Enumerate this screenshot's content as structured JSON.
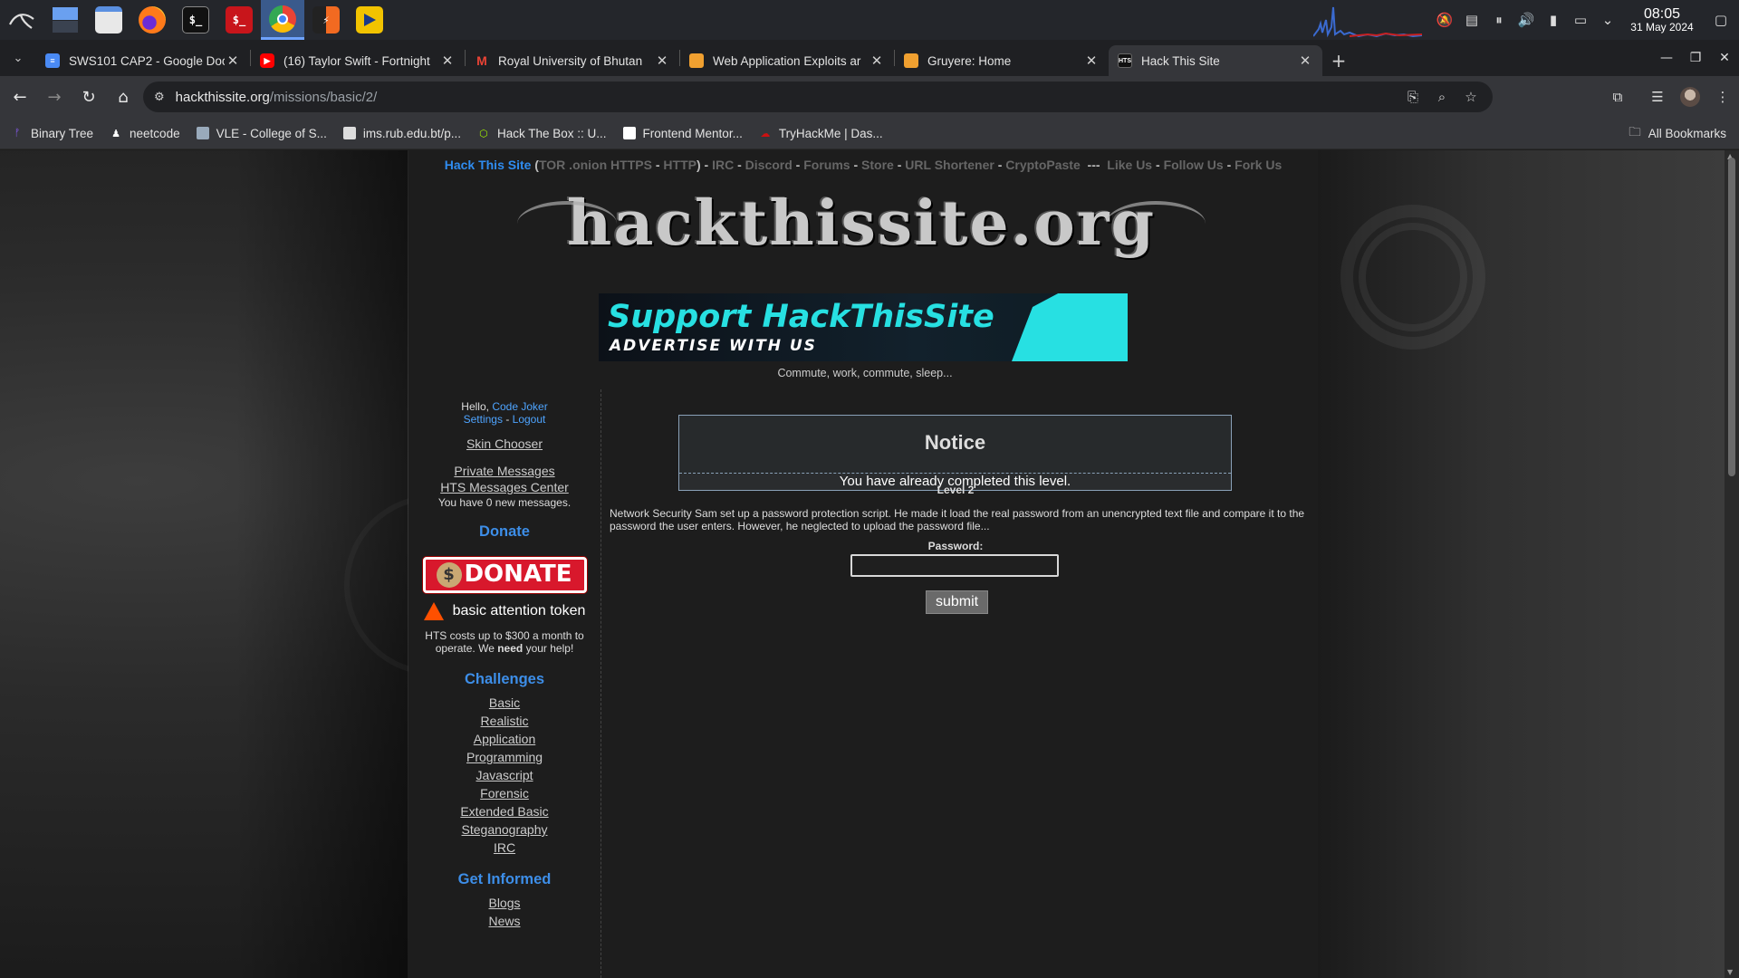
{
  "taskbar": {
    "apps": [
      {
        "name": "kali-menu-icon"
      },
      {
        "name": "workspace-icon"
      },
      {
        "name": "file-manager-icon"
      },
      {
        "name": "firefox-icon"
      },
      {
        "name": "terminal-icon",
        "glyph": "$_"
      },
      {
        "name": "root-terminal-icon",
        "glyph": "$_"
      },
      {
        "name": "chrome-icon"
      },
      {
        "name": "burpsuite-icon"
      },
      {
        "name": "media-player-icon"
      }
    ],
    "clock": {
      "time": "08:05",
      "date": "31 May 2024"
    }
  },
  "tabs": [
    {
      "title": "SWS101 CAP2 - Google Doc",
      "icon": "google-docs-icon",
      "color": "#4a8af4"
    },
    {
      "title": "(16) Taylor Swift - Fortnight",
      "icon": "youtube-icon",
      "color": "#ff0000"
    },
    {
      "title": "Royal University of Bhutan",
      "icon": "gmail-icon",
      "color": "#ea4335"
    },
    {
      "title": "Web Application Exploits ar",
      "icon": "gruyere-icon",
      "color": "#f0a030"
    },
    {
      "title": "Gruyere: Home",
      "icon": "gruyere-icon",
      "color": "#f0a030"
    },
    {
      "title": "Hack This Site",
      "icon": "hts-icon",
      "color": "#222222"
    }
  ],
  "address": {
    "domain": "hackthissite.org",
    "path": "/missions/basic/2/"
  },
  "bookmarks": [
    {
      "label": "Binary Tree",
      "icon": "binarytree-icon",
      "color": "#8a5cf6"
    },
    {
      "label": "neetcode",
      "icon": "neetcode-icon",
      "color": "#ffffff"
    },
    {
      "label": "VLE - College of S...",
      "icon": "vle-icon",
      "color": "#9ab"
    },
    {
      "label": "ims.rub.edu.bt/p...",
      "icon": "ims-icon",
      "color": "#ddd"
    },
    {
      "label": "Hack The Box :: U...",
      "icon": "htb-icon",
      "color": "#9fef00"
    },
    {
      "label": "Frontend Mentor...",
      "icon": "frontend-mentor-icon",
      "color": "#fff"
    },
    {
      "label": "TryHackMe | Das...",
      "icon": "tryhackme-icon",
      "color": "#c11"
    }
  ],
  "all_bookmarks": "All Bookmarks",
  "site": {
    "topnav": {
      "brand": "Hack This Site",
      "links_inner": [
        "TOR .onion HTTPS",
        "HTTP"
      ],
      "links": [
        "IRC",
        "Discord",
        "Forums",
        "Store",
        "URL Shortener",
        "CryptoPaste"
      ],
      "social": [
        "Like Us",
        "Follow Us",
        "Fork Us"
      ]
    },
    "logo_text": "hackthissite.org",
    "banner": {
      "line1": "Support HackThisSite",
      "line2": "ADVERTISE WITH US"
    },
    "tagline": "Commute, work, commute, sleep...",
    "user": {
      "hello": "Hello,",
      "name": "Code Joker",
      "settings": "Settings",
      "logout": "Logout"
    },
    "skin_chooser": "Skin Chooser",
    "private_messages": "Private Messages",
    "messages_center": "HTS Messages Center",
    "new_messages": "You have 0 new messages.",
    "donate_heading": "Donate",
    "donate_button": "DONATE",
    "bat_label": "basic attention token",
    "costs_text_1": "HTS costs up to $300 a month to operate. We",
    "costs_text_bold": "need",
    "costs_text_2": "your help!",
    "challenges_heading": "Challenges",
    "challenges": [
      "Basic",
      "Realistic",
      "Application",
      "Programming",
      "Javascript",
      "Forensic",
      "Extended Basic",
      "Steganography",
      "IRC"
    ],
    "informed_heading": "Get Informed",
    "informed": [
      "Blogs",
      "News"
    ],
    "notice_title": "Notice",
    "notice_msg": "You have already completed this level.",
    "level": "Level 2",
    "description": "Network Security Sam set up a password protection script. He made it load the real password from an unencrypted text file and compare it to the password the user enters. However, he neglected to upload the password file...",
    "password_label": "Password:",
    "submit_label": "submit"
  }
}
